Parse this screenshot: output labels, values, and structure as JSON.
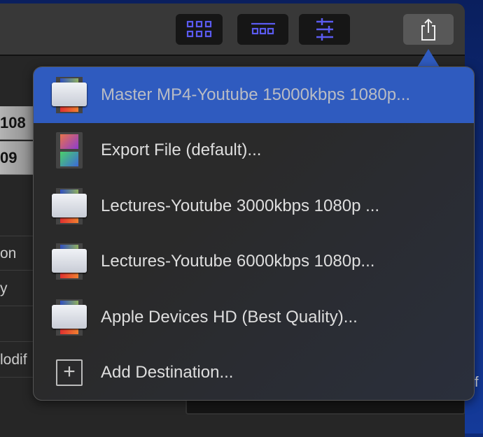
{
  "toolbar": {
    "buttons": [
      "browser-grid",
      "timeline",
      "inspector",
      "share"
    ]
  },
  "left_panel": {
    "gray_rows": [
      "108",
      "09"
    ],
    "rows": [
      "on",
      "y",
      "",
      "lodif"
    ]
  },
  "edge_text": "f",
  "share_menu": {
    "selected_index": 0,
    "items": [
      {
        "label": "Master MP4-Youtube 15000kbps 1080p...",
        "icon": "compressor-icon"
      },
      {
        "label": "Export File (default)...",
        "icon": "film-icon"
      },
      {
        "label": "Lectures-Youtube 3000kbps 1080p ...",
        "icon": "compressor-icon"
      },
      {
        "label": "Lectures-Youtube 6000kbps 1080p...",
        "icon": "compressor-icon"
      },
      {
        "label": "Apple Devices HD (Best Quality)...",
        "icon": "compressor-icon"
      },
      {
        "label": "Add Destination...",
        "icon": "plus-icon"
      }
    ]
  },
  "colors": {
    "accent": "#5b5bf0",
    "selection": "#2f5bbf"
  }
}
